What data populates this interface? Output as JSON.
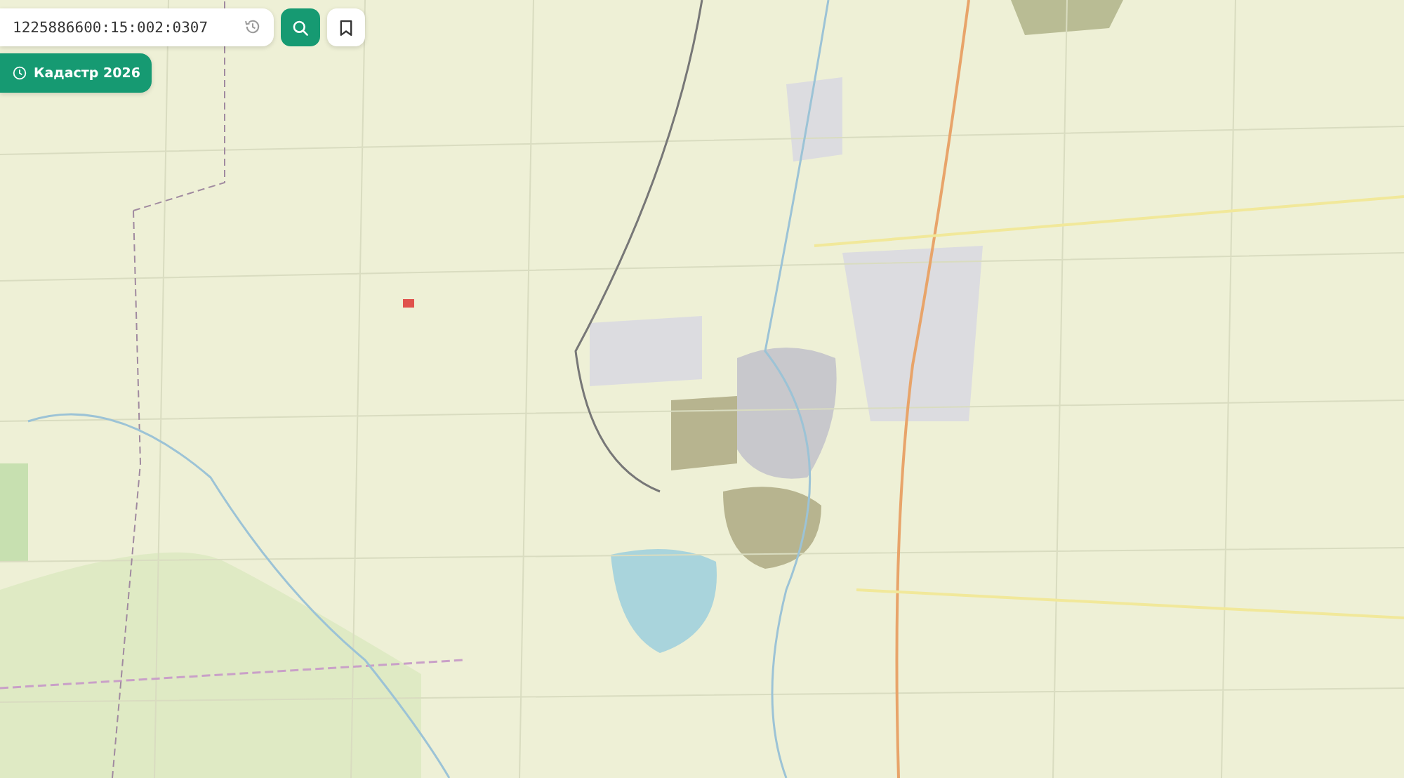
{
  "search": {
    "value": "1225886600:15:002:0307"
  },
  "cadastre_button": {
    "label": "Кадастр 2026"
  }
}
